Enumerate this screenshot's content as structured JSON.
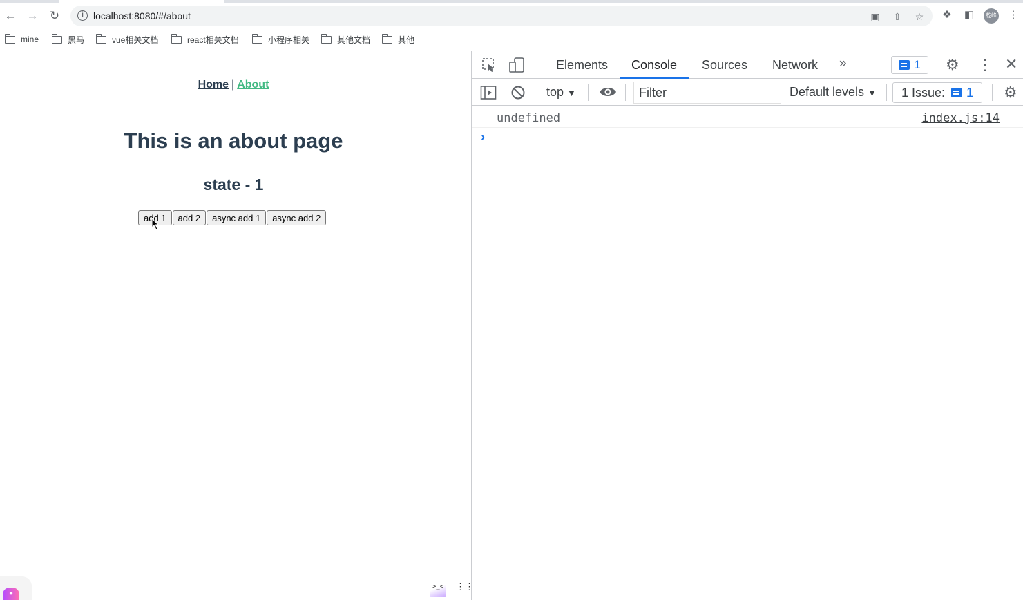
{
  "browser": {
    "url": "localhost:8080/#/about",
    "avatar_text": "乾峰",
    "bookmarks": [
      "mine",
      "黑马",
      "vue相关文档",
      "react相关文档",
      "小程序相关",
      "其他文档",
      "其他"
    ]
  },
  "app": {
    "nav": {
      "home": "Home",
      "separator": "|",
      "about": "About"
    },
    "title": "This is an about page",
    "state_text": "state - 1",
    "buttons": [
      "add 1",
      "add 2",
      "async add 1",
      "async add 2"
    ]
  },
  "devtools": {
    "tabs": [
      "Elements",
      "Console",
      "Sources",
      "Network"
    ],
    "active_tab": "Console",
    "message_count": "1",
    "context": "top",
    "filter_placeholder": "Filter",
    "levels": "Default levels",
    "issues_label": "1 Issue:",
    "issues_count": "1",
    "console": {
      "entries": [
        {
          "value": "undefined",
          "source": "index.js:14"
        }
      ],
      "prompt": "›"
    },
    "accent": "#1a73e8"
  },
  "colors": {
    "vue_green": "#42b983",
    "text_dark": "#2c3e50"
  }
}
